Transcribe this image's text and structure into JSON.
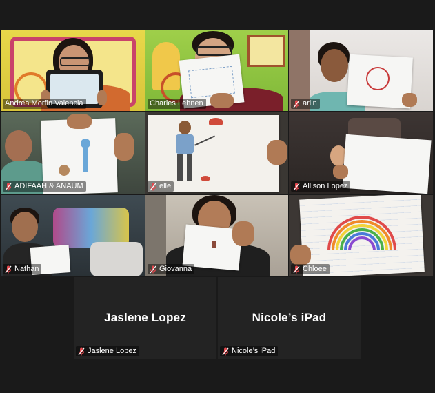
{
  "participants": [
    {
      "name": "Andrea Morfin Valencia",
      "muted": false,
      "active_speaker": true
    },
    {
      "name": "Charles Lehnen",
      "muted": false,
      "active_speaker": false
    },
    {
      "name": "arlin",
      "muted": true,
      "active_speaker": false
    },
    {
      "name": "ADIFAAH & ANAUM",
      "muted": true,
      "active_speaker": false
    },
    {
      "name": "elle",
      "muted": true,
      "active_speaker": false
    },
    {
      "name": "Allison Lopez",
      "muted": true,
      "active_speaker": false
    },
    {
      "name": "Nathan",
      "muted": true,
      "active_speaker": false
    },
    {
      "name": "Giovanna",
      "muted": true,
      "active_speaker": false
    },
    {
      "name": "Chloee",
      "muted": true,
      "active_speaker": false
    },
    {
      "name": "Jaslene Lopez",
      "muted": true,
      "active_speaker": false,
      "video_off": true
    },
    {
      "name": "Nicole’s iPad",
      "muted": true,
      "active_speaker": false,
      "video_off": true
    }
  ],
  "colors": {
    "background": "#1a1a1a",
    "tile_background": "#2b2b2b",
    "active_speaker_border": "#f2d33a",
    "muted_icon": "#e5484d"
  },
  "icons": {
    "muted": "microphone-muted-icon"
  }
}
